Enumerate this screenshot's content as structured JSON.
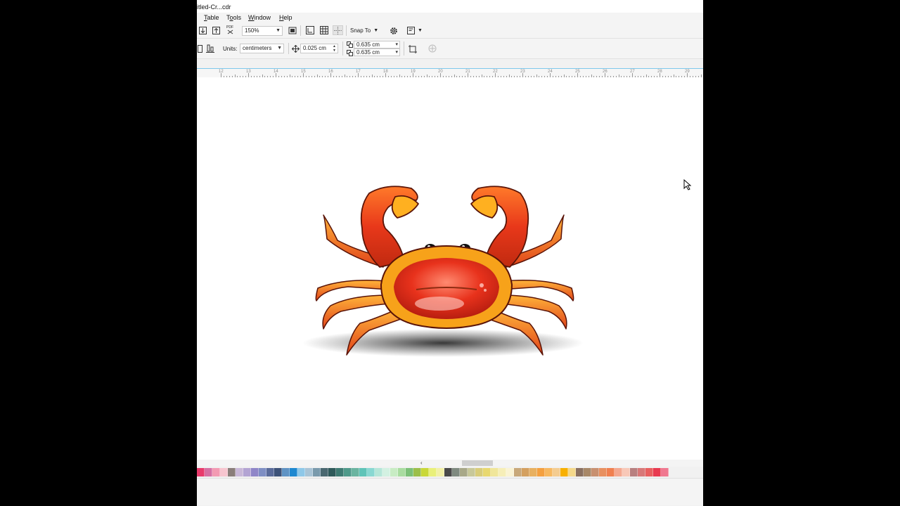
{
  "window": {
    "title": "itled-Cr...cdr"
  },
  "menu": [
    {
      "label": "Table",
      "u": "T",
      "rest": "able"
    },
    {
      "label": "Tools",
      "pre": "T",
      "u": "o",
      "rest": "ols"
    },
    {
      "label": "Window",
      "u": "W",
      "rest": "indow"
    },
    {
      "label": "Help",
      "u": "H",
      "rest": "elp"
    }
  ],
  "toolbar": {
    "zoom_value": "150%",
    "pdf_label": "PDF",
    "snap_label": "Snap To"
  },
  "property_bar": {
    "units_label": "Units:",
    "units_value": "centimeters",
    "nudge_value": "0.025 cm",
    "dup_x_value": "0.635 cm",
    "dup_y_value": "0.635 cm"
  },
  "ruler": {
    "numbers": [
      "12",
      "13",
      "14",
      "15",
      "16",
      "17",
      "18",
      "19",
      "20",
      "21",
      "22",
      "23",
      "24",
      "25",
      "26",
      "27",
      "28",
      "29"
    ]
  },
  "canvas": {
    "illustration": "crab"
  },
  "palette": {
    "colors": [
      "#e83a6b",
      "#d66fa3",
      "#f39bb3",
      "#f7c5cf",
      "#8a7e7a",
      "#c9b8d8",
      "#b3a4d3",
      "#8f86c8",
      "#7f8fc4",
      "#5a6b9a",
      "#3d5278",
      "#5f93c4",
      "#1e88d0",
      "#8fc8e8",
      "#a9c4d6",
      "#7a9aac",
      "#4a6870",
      "#2f5a5a",
      "#3e7a72",
      "#4f9a8a",
      "#6ab4a0",
      "#5fc4b8",
      "#89d8d2",
      "#b5e6d8",
      "#d3f1e2",
      "#c8ecc4",
      "#a9dca0",
      "#7cc078",
      "#9cbf4a",
      "#c9d838",
      "#e9f07a",
      "#f2f0a8",
      "#4a4a4a",
      "#7f8a80",
      "#a8a888",
      "#c8c89a",
      "#d8cc7a",
      "#e8d870",
      "#f0e69a",
      "#f6eeb8",
      "#faf3d4",
      "#c8a87a",
      "#d4a060",
      "#e8b060",
      "#f4a040",
      "#f7b860",
      "#f4cc90",
      "#f8b000",
      "#f4d88a",
      "#8a7060",
      "#a88868",
      "#c89070",
      "#e89060",
      "#f08050",
      "#f4a890",
      "#f8c8b8",
      "#b88080",
      "#d87878",
      "#e86060",
      "#e83a50",
      "#f07890"
    ]
  }
}
